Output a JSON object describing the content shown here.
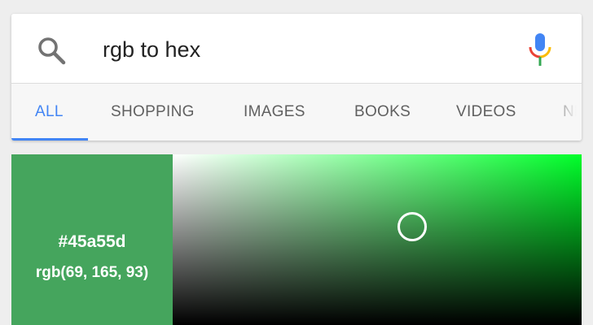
{
  "search": {
    "query": "rgb to hex"
  },
  "tabs": [
    {
      "label": "ALL",
      "active": true
    },
    {
      "label": "SHOPPING",
      "active": false
    },
    {
      "label": "IMAGES",
      "active": false
    },
    {
      "label": "BOOKS",
      "active": false
    },
    {
      "label": "VIDEOS",
      "active": false
    },
    {
      "label": "NE",
      "active": false
    }
  ],
  "color_picker": {
    "hex": "#45a55d",
    "rgb": "rgb(69, 165, 93)",
    "swatch_color": "#45a55d",
    "hue_color": "#00ff2a"
  },
  "colors": {
    "accent": "#4285f4",
    "tab_text": "#606060",
    "mic_blue": "#4285f4",
    "mic_red": "#ea4335",
    "mic_yellow": "#fbbc05",
    "mic_green": "#34a853"
  },
  "icons": {
    "search": "search-icon",
    "mic": "mic-icon"
  }
}
